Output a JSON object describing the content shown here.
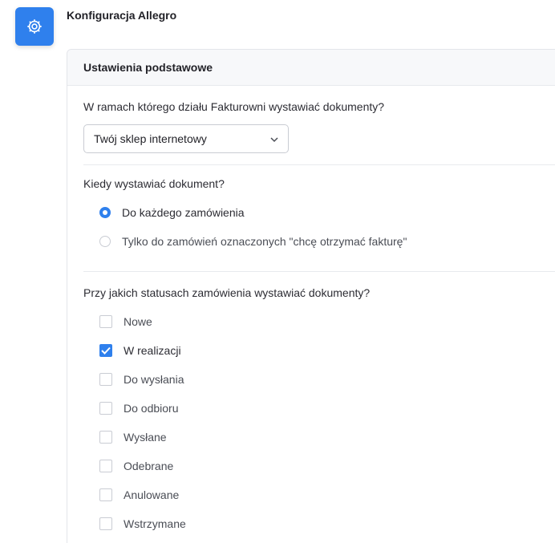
{
  "app": {
    "title": "Konfiguracja Allegro",
    "icon": "gear-icon",
    "accent_color": "#2f80ed"
  },
  "card": {
    "header": "Ustawienia podstawowe",
    "department": {
      "question": "W ramach którego działu Fakturowni wystawiać dokumenty?",
      "selected": "Twój sklep internetowy"
    },
    "when": {
      "question": "Kiedy wystawiać dokument?",
      "options": [
        {
          "label": "Do każdego zamówienia",
          "checked": true
        },
        {
          "label": "Tylko do zamówień oznaczonych \"chcę otrzymać fakturę\"",
          "checked": false
        }
      ]
    },
    "statuses": {
      "question": "Przy jakich statusach zamówienia wystawiać dokumenty?",
      "options": [
        {
          "label": "Nowe",
          "checked": false
        },
        {
          "label": "W realizacji",
          "checked": true
        },
        {
          "label": "Do wysłania",
          "checked": false
        },
        {
          "label": "Do odbioru",
          "checked": false
        },
        {
          "label": "Wysłane",
          "checked": false
        },
        {
          "label": "Odebrane",
          "checked": false
        },
        {
          "label": "Anulowane",
          "checked": false
        },
        {
          "label": "Wstrzymane",
          "checked": false
        }
      ]
    }
  }
}
